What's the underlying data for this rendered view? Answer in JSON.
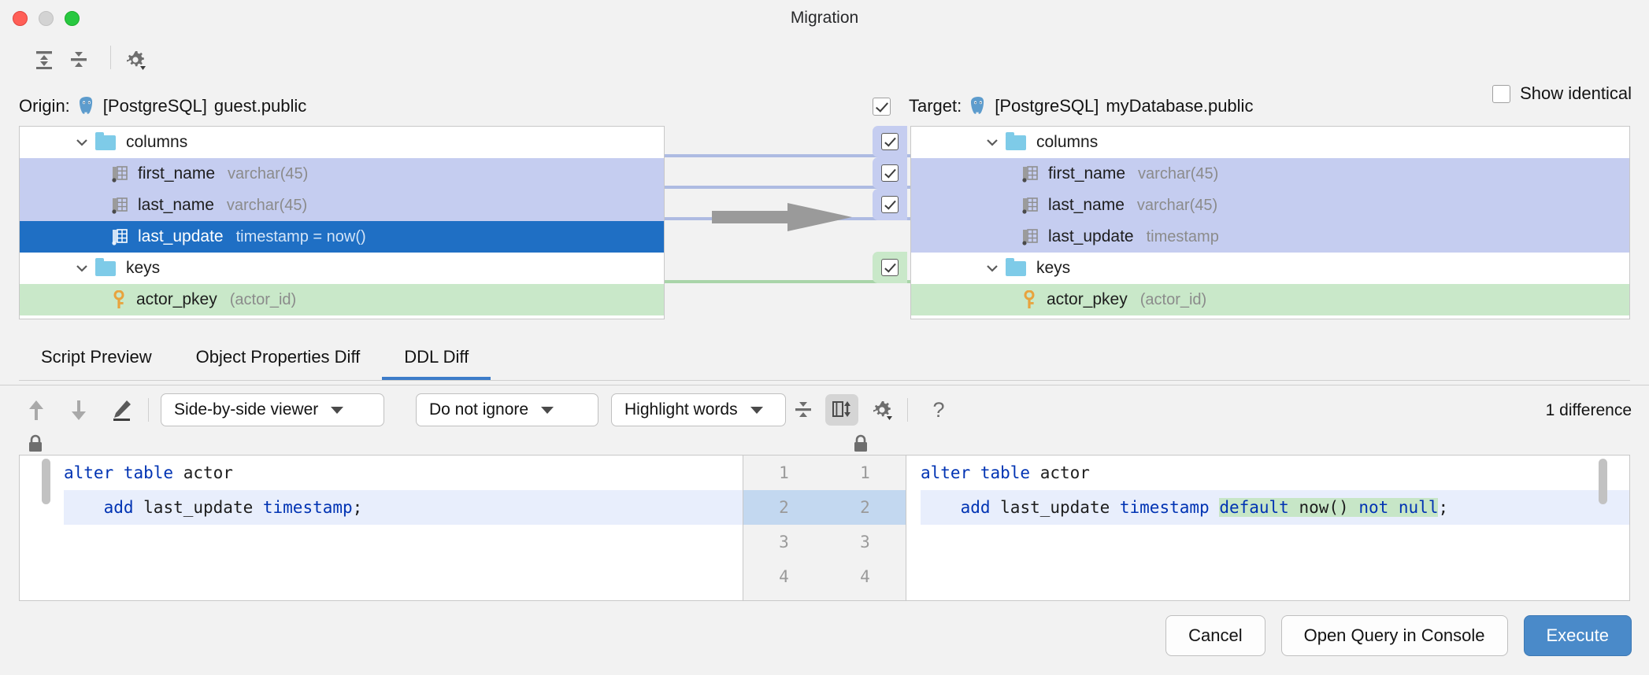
{
  "window": {
    "title": "Migration"
  },
  "traffic": {
    "close": "close",
    "minimize": "minimize",
    "maximize": "maximize"
  },
  "toolbar": {
    "expand_all": "expand-all",
    "collapse_all": "collapse-all",
    "settings": "settings",
    "show_identical_label": "Show identical",
    "show_identical_checked": false
  },
  "origin": {
    "label": "Origin:",
    "db_kind": "[PostgreSQL]",
    "schema": "guest.public",
    "icon": "postgresql-icon"
  },
  "target": {
    "label": "Target:",
    "db_kind": "[PostgreSQL]",
    "schema": "myDatabase.public",
    "icon": "postgresql-icon",
    "checked": true
  },
  "tree_left": {
    "rows": [
      {
        "name": "columns",
        "type": "",
        "kind": "folder",
        "indent": 1,
        "state": "plain",
        "expanded": true
      },
      {
        "name": "first_name",
        "type": "varchar(45)",
        "kind": "column",
        "indent": 2,
        "state": "changed"
      },
      {
        "name": "last_name",
        "type": "varchar(45)",
        "kind": "column",
        "indent": 2,
        "state": "changed"
      },
      {
        "name": "last_update",
        "type": "timestamp = now()",
        "kind": "column",
        "indent": 2,
        "state": "selected"
      },
      {
        "name": "keys",
        "type": "",
        "kind": "folder",
        "indent": 1,
        "state": "plain",
        "expanded": true
      },
      {
        "name": "actor_pkey",
        "type": "(actor_id)",
        "kind": "key",
        "indent": 2,
        "state": "added"
      }
    ]
  },
  "tree_right": {
    "rows": [
      {
        "name": "columns",
        "type": "",
        "kind": "folder",
        "indent": 1,
        "state": "plain",
        "expanded": true,
        "checked": false
      },
      {
        "name": "first_name",
        "type": "varchar(45)",
        "kind": "column",
        "indent": 2,
        "state": "changed",
        "checked": true
      },
      {
        "name": "last_name",
        "type": "varchar(45)",
        "kind": "column",
        "indent": 2,
        "state": "changed",
        "checked": true
      },
      {
        "name": "last_update",
        "type": "timestamp",
        "kind": "column",
        "indent": 2,
        "state": "changed",
        "checked": true
      },
      {
        "name": "keys",
        "type": "",
        "kind": "folder",
        "indent": 1,
        "state": "plain",
        "expanded": true,
        "checked": false
      },
      {
        "name": "actor_pkey",
        "type": "(actor_id)",
        "kind": "key",
        "indent": 2,
        "state": "added",
        "checked": true
      }
    ]
  },
  "tabs": [
    {
      "label": "Script Preview",
      "active": false
    },
    {
      "label": "Object Properties Diff",
      "active": false
    },
    {
      "label": "DDL Diff",
      "active": true
    }
  ],
  "diff_toolbar": {
    "prev_diff": "arrow-up-icon",
    "next_diff": "arrow-down-icon",
    "edit": "pencil-icon",
    "viewer_mode": "Side-by-side viewer",
    "ignore_mode": "Do not ignore",
    "highlight_mode": "Highlight words",
    "collapse_unchanged": "collapse-unchanged-icon",
    "synchronize_scroll": "synchronize-scroll-icon",
    "settings": "gear-icon",
    "help": "?",
    "difference_count": "1 difference"
  },
  "editor": {
    "lock_left": "lock-icon",
    "lock_right": "lock-icon",
    "left_lines": [
      {
        "num": "1",
        "tokens": [
          {
            "t": "alter table ",
            "c": "kw"
          },
          {
            "t": "actor",
            "c": ""
          }
        ],
        "hl": false
      },
      {
        "num": "2",
        "tokens": [
          {
            "t": "    ",
            "c": ""
          },
          {
            "t": "add ",
            "c": "kw"
          },
          {
            "t": "last_update ",
            "c": ""
          },
          {
            "t": "timestamp",
            "c": "kw"
          },
          {
            "t": ";",
            "c": ""
          }
        ],
        "hl": true
      },
      {
        "num": "3",
        "tokens": [],
        "hl": false
      },
      {
        "num": "4",
        "tokens": [],
        "hl": false
      }
    ],
    "right_lines": [
      {
        "num": "1",
        "tokens": [
          {
            "t": "alter table ",
            "c": "kw"
          },
          {
            "t": "actor",
            "c": ""
          }
        ],
        "hl": false
      },
      {
        "num": "2",
        "tokens": [
          {
            "t": "    ",
            "c": ""
          },
          {
            "t": "add ",
            "c": "kw"
          },
          {
            "t": "last_update ",
            "c": ""
          },
          {
            "t": "timestamp ",
            "c": "kw"
          },
          {
            "t": "default ",
            "c": "kw add"
          },
          {
            "t": "now() ",
            "c": "add"
          },
          {
            "t": "not null",
            "c": "kw add"
          },
          {
            "t": ";",
            "c": ""
          }
        ],
        "hl": true
      },
      {
        "num": "3",
        "tokens": [],
        "hl": false
      },
      {
        "num": "4",
        "tokens": [],
        "hl": false
      }
    ],
    "left_text_line1": "alter table actor",
    "left_text_line2": "    add last_update timestamp;",
    "right_text_line1": "alter table actor",
    "right_text_line2": "    add last_update timestamp default now() not null;"
  },
  "footer": {
    "cancel": "Cancel",
    "open_query": "Open Query in Console",
    "execute": "Execute"
  },
  "colors": {
    "accent": "#3d7cc9",
    "primary_button": "#4a8ac9",
    "added_row": "#c9e8c9",
    "changed_row": "#c5cdf0",
    "selected_row": "#1f6fc4",
    "added_code": "#c7e6c7",
    "keyword": "#0033b3"
  }
}
